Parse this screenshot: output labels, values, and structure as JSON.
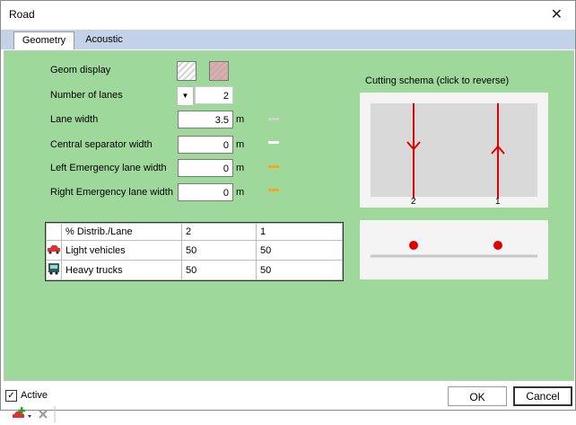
{
  "window": {
    "title": "Road"
  },
  "tabs": [
    {
      "label": "Geometry"
    },
    {
      "label": "Acoustic"
    }
  ],
  "form": {
    "geom_display_label": "Geom display",
    "lanes_label": "Number of lanes",
    "lanes_value": "2",
    "lane_width_label": "Lane width",
    "lane_width_value": "3.5",
    "central_sep_label": "Central separator width",
    "central_sep_value": "0",
    "left_em_label": "Left Emergency lane width",
    "left_em_value": "0",
    "right_em_label": "Right Emergency lane width",
    "right_em_value": "0",
    "unit": "m"
  },
  "colors": {
    "lane": "#d0d0d0",
    "separator": "#ffffff",
    "emergency": "#f5a623",
    "schema_line": "#e00000",
    "panel": "#9ed89a"
  },
  "distribution": {
    "header": [
      "% Distrib./Lane",
      "2",
      "1"
    ],
    "rows": [
      {
        "icon": "car-icon",
        "label": "Light vehicles",
        "values": [
          "50",
          "50"
        ]
      },
      {
        "icon": "truck-icon",
        "label": "Heavy trucks",
        "values": [
          "50",
          "50"
        ]
      }
    ]
  },
  "schema": {
    "title": "Cutting schema (click to reverse)",
    "lane_labels": [
      "2",
      "1"
    ]
  },
  "footer": {
    "active_label": "Active",
    "ok_label": "OK",
    "cancel_label": "Cancel"
  }
}
